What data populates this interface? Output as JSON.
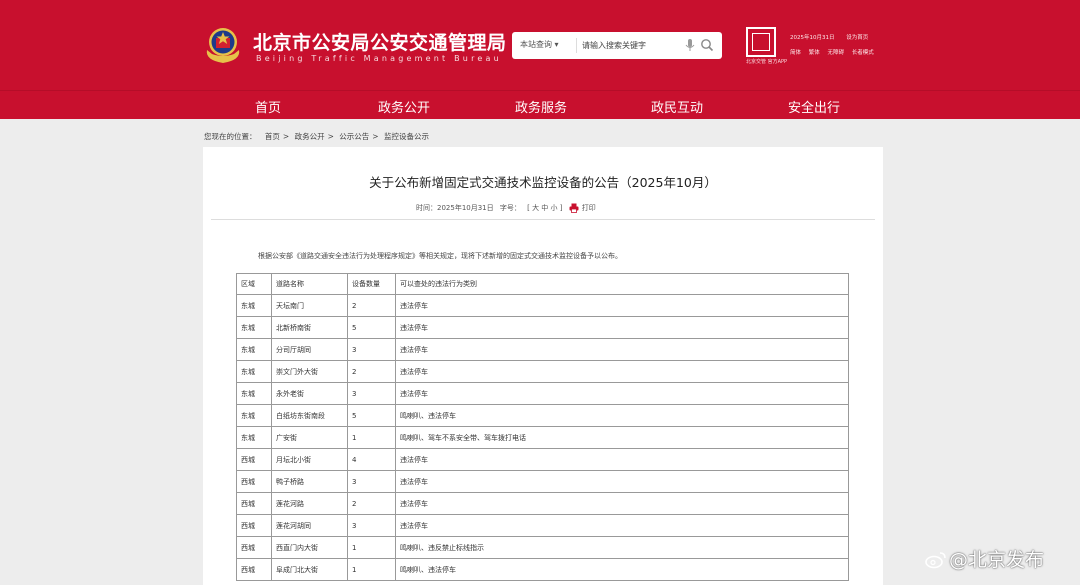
{
  "header": {
    "title_cn": "北京市公安局公安交通管理局",
    "title_en": "Beijing Traffic Management Bureau",
    "search": {
      "scope": "本站查询 ▾",
      "placeholder": "请输入搜索关键字"
    },
    "qr_caption": "北京交管 官方APP",
    "tools_row1": [
      "2025年10月31日",
      "设为首页"
    ],
    "tools_row2": [
      "简体",
      "繁体",
      "无障碍",
      "长者模式"
    ]
  },
  "nav": [
    "首页",
    "政务公开",
    "政务服务",
    "政民互动",
    "安全出行"
  ],
  "breadcrumb": {
    "label": "您现在的位置：",
    "items": [
      "首页",
      "政务公开",
      "公示公告",
      "监控设备公示"
    ]
  },
  "article": {
    "title": "关于公布新增固定式交通技术监控设备的公告（2025年10月）",
    "meta": {
      "date": "时间：2025年10月31日",
      "font_label": "字号：",
      "font_sizes": "[ 大  中  小 ]",
      "print": "打印"
    },
    "intro": "根据公安部《道路交通安全违法行为处理程序规定》等相关规定，现将下述新增的固定式交通技术监控设备予以公布。"
  },
  "table": {
    "headers": [
      "区域",
      "道路名称",
      "设备数量",
      "可以查处的违法行为类别"
    ],
    "rows": [
      [
        "东城",
        "天坛南门",
        "2",
        "违法停车"
      ],
      [
        "东城",
        "北新桥南街",
        "5",
        "违法停车"
      ],
      [
        "东城",
        "分司厅胡同",
        "3",
        "违法停车"
      ],
      [
        "东城",
        "崇文门外大街",
        "2",
        "违法停车"
      ],
      [
        "东城",
        "永外老街",
        "3",
        "违法停车"
      ],
      [
        "东城",
        "白纸坊东街南段",
        "5",
        "鸣喇叭、违法停车"
      ],
      [
        "东城",
        "广安街",
        "1",
        "鸣喇叭、驾车不系安全带、驾车拨打电话"
      ],
      [
        "西城",
        "月坛北小街",
        "4",
        "违法停车"
      ],
      [
        "西城",
        "鸭子桥路",
        "3",
        "违法停车"
      ],
      [
        "西城",
        "莲花河路",
        "2",
        "违法停车"
      ],
      [
        "西城",
        "莲花河胡同",
        "3",
        "违法停车"
      ],
      [
        "西城",
        "西直门内大街",
        "1",
        "鸣喇叭、违反禁止标线指示"
      ],
      [
        "西城",
        "阜成门北大街",
        "1",
        "鸣喇叭、违法停车"
      ]
    ]
  },
  "watermark": "@北京发布",
  "colors": {
    "brand": "#c8102e",
    "page_bg": "#ededed"
  }
}
